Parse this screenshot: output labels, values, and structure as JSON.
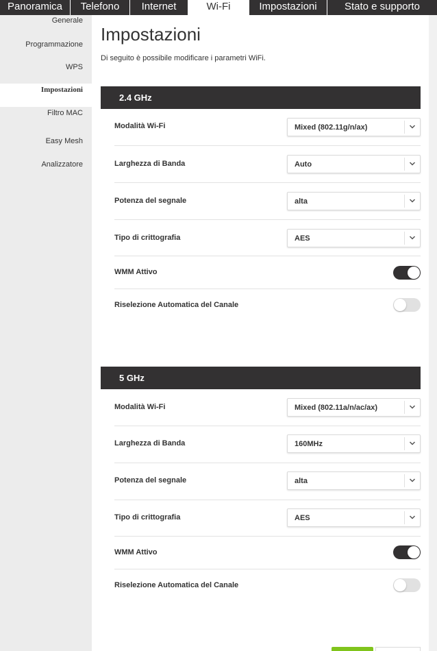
{
  "nav": {
    "tabs": [
      "Panoramica",
      "Telefono",
      "Internet",
      "Wi-Fi",
      "Impostazioni",
      "Stato e supporto"
    ],
    "active": "Wi-Fi"
  },
  "sidebar": {
    "items": [
      "Generale",
      "Programmazione",
      "WPS",
      "Impostazioni",
      "Filtro MAC",
      "Easy Mesh",
      "Analizzatore"
    ],
    "active": "Impostazioni"
  },
  "page": {
    "title": "Impostazioni",
    "description": "Di seguito è possibile modificare i parametri WiFi."
  },
  "band24": {
    "title": "2.4 GHz",
    "mode_label": "Modalità Wi-Fi",
    "mode_value": "Mixed (802.11g/n/ax)",
    "bandwidth_label": "Larghezza di Banda",
    "bandwidth_value": "Auto",
    "power_label": "Potenza del segnale",
    "power_value": "alta",
    "encryption_label": "Tipo di crittografia",
    "encryption_value": "AES",
    "wmm_label": "WMM Attivo",
    "wmm_on": true,
    "auto_channel_label": "Riselezione Automatica del Canale",
    "auto_channel_on": false
  },
  "band5": {
    "title": "5 GHz",
    "mode_label": "Modalità Wi-Fi",
    "mode_value": "Mixed (802.11a/n/ac/ax)",
    "bandwidth_label": "Larghezza di Banda",
    "bandwidth_value": "160MHz",
    "power_label": "Potenza del segnale",
    "power_value": "alta",
    "encryption_label": "Tipo di crittografia",
    "encryption_value": "AES",
    "wmm_label": "WMM Attivo",
    "wmm_on": true,
    "auto_channel_label": "Riselezione Automatica del Canale",
    "auto_channel_on": false
  },
  "colors": {
    "header_dark": "#333132",
    "accent_green": "#80c41c",
    "sidebar_bg": "#ececec"
  }
}
